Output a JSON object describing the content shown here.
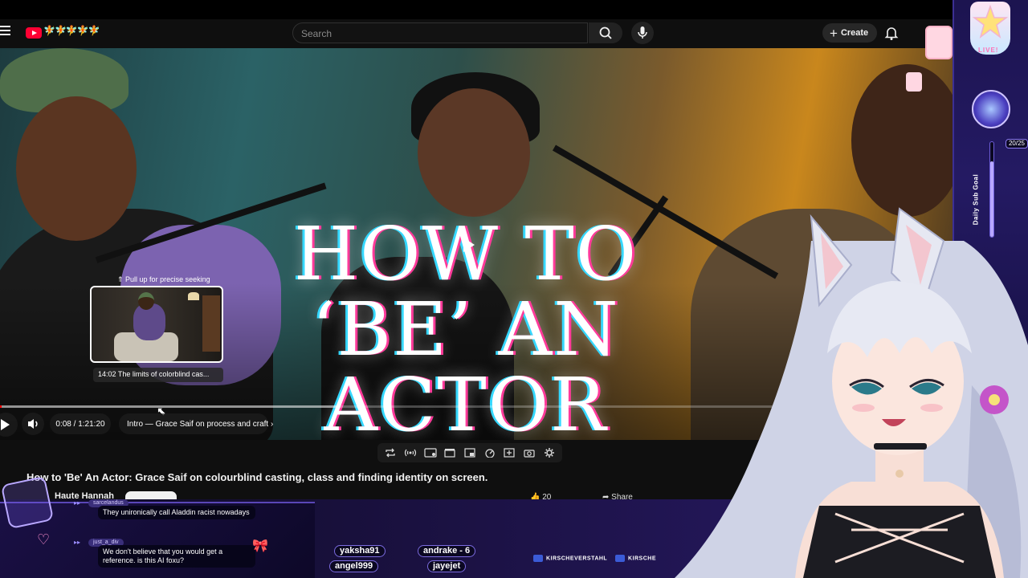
{
  "header": {
    "logo_doodle": "🧚🧚🧚🧚🧚",
    "search_placeholder": "Search",
    "create_label": "Create"
  },
  "player": {
    "overlay_title_lines": [
      "HOW TO",
      "‘BE’ AN",
      "ACTOR"
    ],
    "seek_hint": "⇑ Pull up for precise seeking",
    "preview_chapter": "14:02  The limits of colorblind cas...",
    "time": "0:08 / 1:21:20",
    "current_chapter": "Intro — Grace Saif on process and craft ›",
    "progress_fraction": 0.0016
  },
  "video": {
    "title": "How to 'Be' An Actor: Grace Saif on colourblind casting, class and finding identity on screen.",
    "channel": "Haute Hannah",
    "likes": "20",
    "share_label": "Share"
  },
  "chat": {
    "messages": [
      {
        "user": "sarcelandus",
        "text": "They unironically call Aladdin racist nowadays"
      },
      {
        "user": "just_a_div",
        "text": "We don't believe that you would get a reference. is this AI foxu?"
      }
    ]
  },
  "ticker": {
    "names": [
      "yaksha91",
      "andrake - 6",
      "angel999",
      "jayejet"
    ],
    "socials": [
      "KIRSCHEVERSTAHL",
      "KIRSCHE"
    ]
  },
  "widget": {
    "live_label": "LIVE!",
    "goal_label": "Daily Sub Goal",
    "goal_count": "20/25",
    "goal_fraction": 0.8
  },
  "colors": {
    "accent_red": "#ff0000",
    "overlay_purple": "#5a46b8"
  }
}
